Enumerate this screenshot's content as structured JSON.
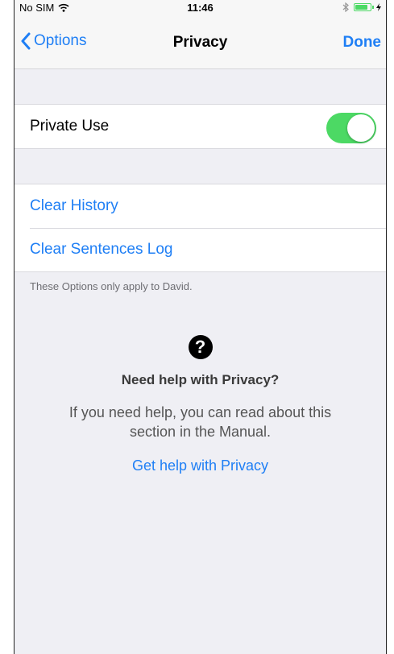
{
  "status_bar": {
    "carrier": "No SIM",
    "time": "11:46"
  },
  "nav": {
    "back_label": "Options",
    "title": "Privacy",
    "done_label": "Done"
  },
  "settings": {
    "private_use": {
      "label": "Private Use",
      "enabled": true
    },
    "actions": [
      "Clear History",
      "Clear Sentences Log"
    ],
    "footer_note": "These Options only apply to David."
  },
  "help": {
    "icon": "?",
    "title": "Need help with Privacy?",
    "body": "If you need help, you can read about this section in the Manual.",
    "link": "Get help with Privacy"
  },
  "colors": {
    "accent": "#1f7ff5",
    "toggle_on": "#4cd964",
    "background": "#efeff4"
  }
}
